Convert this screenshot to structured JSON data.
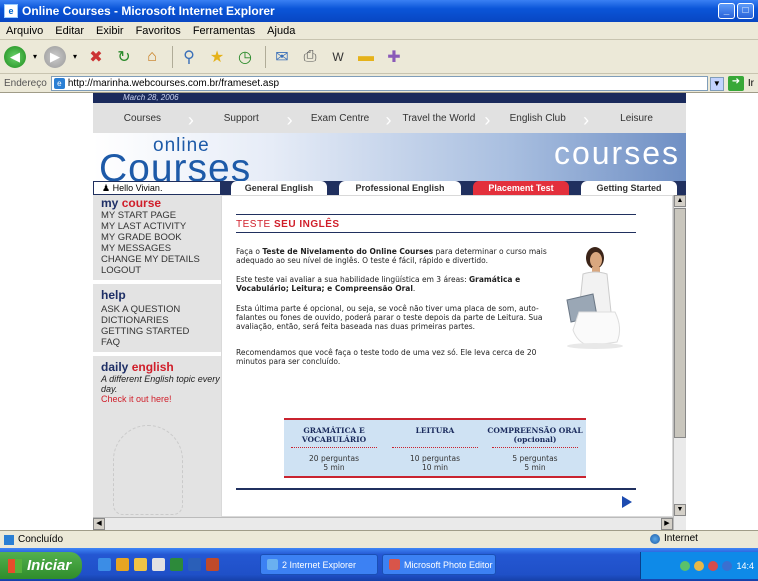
{
  "window": {
    "title": "Online Courses - Microsoft Internet Explorer"
  },
  "menu": [
    "Arquivo",
    "Editar",
    "Exibir",
    "Favoritos",
    "Ferramentas",
    "Ajuda"
  ],
  "address": {
    "label": "Endereço",
    "url": "http://marinha.webcourses.com.br/frameset.asp",
    "go_label": "Ir"
  },
  "site": {
    "date": "March 28, 2006",
    "nav": [
      "Courses",
      "Support",
      "Exam Centre",
      "Travel the World",
      "English Club",
      "Leisure"
    ],
    "logo_small": "online",
    "logo_big": "Courses",
    "logo_right": "courses",
    "hello": "Hello Vivian.",
    "tabs": [
      "General English",
      "Professional English",
      "Placement Test",
      "Getting Started"
    ]
  },
  "sidebar": {
    "my_course_title": "my",
    "my_course_accent": "course",
    "my_course_links": [
      "MY START PAGE",
      "MY LAST ACTIVITY",
      "MY GRADE BOOK",
      "MY MESSAGES",
      "CHANGE MY DETAILS",
      "LOGOUT"
    ],
    "help_title": "help",
    "help_links": [
      "ASK A QUESTION",
      "DICTIONARIES",
      "GETTING STARTED",
      "FAQ"
    ],
    "daily_title": "daily",
    "daily_accent": "english",
    "daily_text": "A different English topic every day.",
    "daily_link": "Check it out here!"
  },
  "content": {
    "title_plain": "TESTE",
    "title_bold": "SEU INGLÊS",
    "p1_a": "Faça o ",
    "p1_b": "Teste de Nivelamento do Online Courses",
    "p1_c": " para determinar o curso mais adequado ao seu nível de inglês. O teste é fácil, rápido e divertido.",
    "p2_a": "Este teste vai avaliar a sua habilidade lingüística em 3 áreas: ",
    "p2_b": "Gramática e Vocabulário; Leitura; e Compreensão Oral",
    "p2_c": ".",
    "p3": "Esta última parte é opcional, ou seja, se você não tiver uma placa de som, auto-falantes ou fones de ouvido, poderá parar o teste depois da parte de Leitura. Sua avaliação, então, será feita baseada nas duas primeiras partes.",
    "p4": "Recomendamos que você faça o teste todo de uma vez só. Ele leva cerca de 20 minutos para ser concluído.",
    "table": {
      "headers": [
        "GRAMÁTICA E VOCABULÁRIO",
        "LEITURA",
        "COMPREENSÃO ORAL (opcional)"
      ],
      "rows": [
        [
          "20 perguntas\n5 min",
          "10 perguntas\n10 min",
          "5 perguntas\n5 min"
        ]
      ]
    }
  },
  "status": {
    "left": "Concluído",
    "zone": "Internet"
  },
  "taskbar": {
    "start": "Iniciar",
    "tasks": [
      "2 Internet Explorer",
      "Microsoft Photo Editor"
    ],
    "clock": "14:4"
  }
}
